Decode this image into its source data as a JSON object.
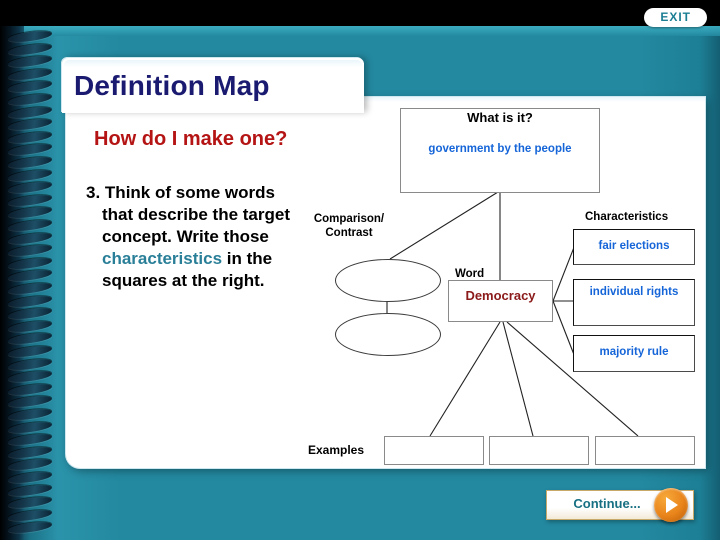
{
  "nav": {
    "exit_label": "EXIT",
    "continue_label": "Continue...",
    "play_icon": "play-triangle-icon"
  },
  "slide": {
    "title": "Definition Map",
    "subtitle": "How do I make one?",
    "step_number": "3.",
    "step_text_a": "Think of some words that describe the target concept. Write those ",
    "step_highlight": "characteristics",
    "step_text_b": " in the squares at the right."
  },
  "diagram": {
    "what_is_it": {
      "heading": "What is it?",
      "value": "government by the people"
    },
    "comparison": {
      "label": "Comparison/ Contrast",
      "oval_1": "",
      "oval_2": ""
    },
    "word": {
      "label": "Word",
      "value": "Democracy"
    },
    "characteristics": {
      "label": "Characteristics",
      "items": [
        "fair elections",
        "individual rights",
        "majority rule"
      ]
    },
    "examples": {
      "label": "Examples",
      "items": [
        "",
        "",
        ""
      ]
    }
  },
  "colors": {
    "background_teal": "#2389a0",
    "title_navy": "#1a1a70",
    "subtitle_red": "#b51414",
    "value_blue": "#1565d8",
    "word_maroon": "#8b1a1a",
    "highlight_teal": "#2a7f98",
    "accent_orange": "#e8831a"
  }
}
